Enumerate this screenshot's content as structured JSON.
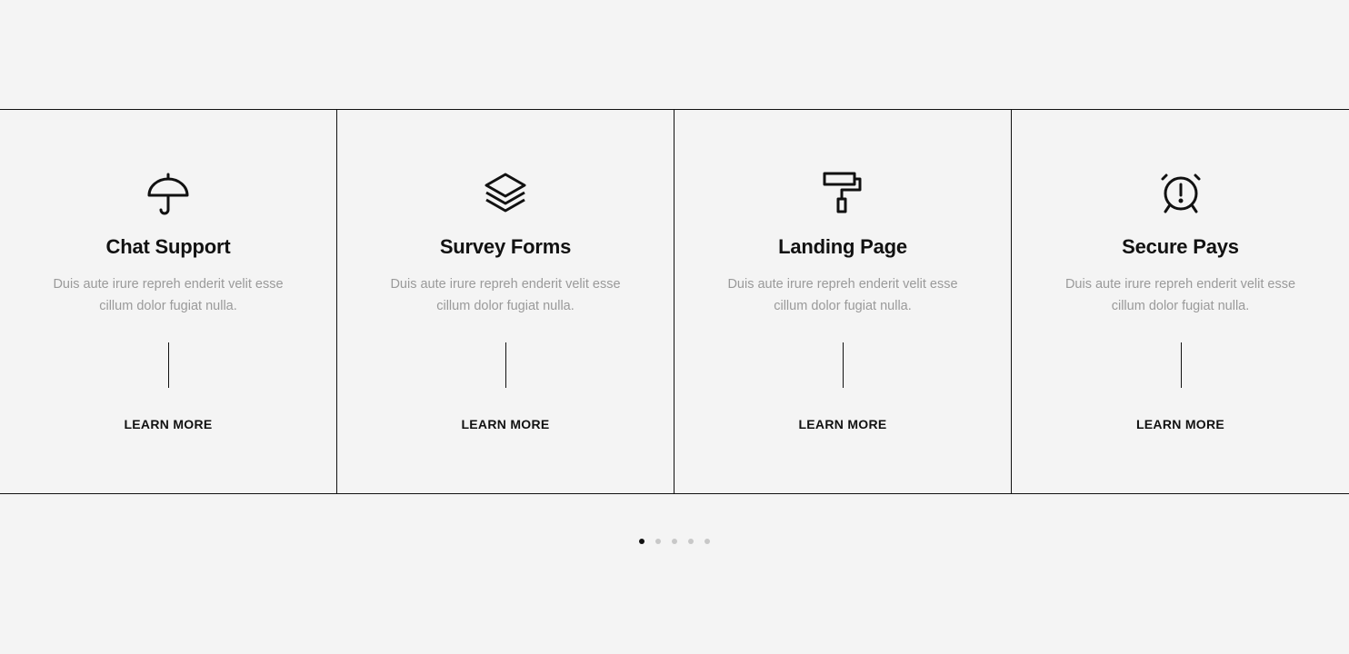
{
  "cards": [
    {
      "icon": "umbrella-icon",
      "title": "Chat Support",
      "description": "Duis aute irure repreh enderit velit esse cillum dolor fugiat nulla.",
      "link_label": "LEARN MORE"
    },
    {
      "icon": "layers-icon",
      "title": "Survey Forms",
      "description": "Duis aute irure repreh enderit velit esse cillum dolor fugiat nulla.",
      "link_label": "LEARN MORE"
    },
    {
      "icon": "paint-roller-icon",
      "title": "Landing Page",
      "description": "Duis aute irure repreh enderit velit esse cillum dolor fugiat nulla.",
      "link_label": "LEARN MORE"
    },
    {
      "icon": "alarm-clock-icon",
      "title": "Secure Pays",
      "description": "Duis aute irure repreh enderit velit esse cillum dolor fugiat nulla.",
      "link_label": "LEARN MORE"
    }
  ],
  "pagination": {
    "total": 5,
    "active_index": 0
  },
  "colors": {
    "background": "#f4f4f4",
    "text": "#111111",
    "muted_text": "#9a9a9a",
    "dot_inactive": "#c8c8c8",
    "dot_active": "#111111"
  }
}
